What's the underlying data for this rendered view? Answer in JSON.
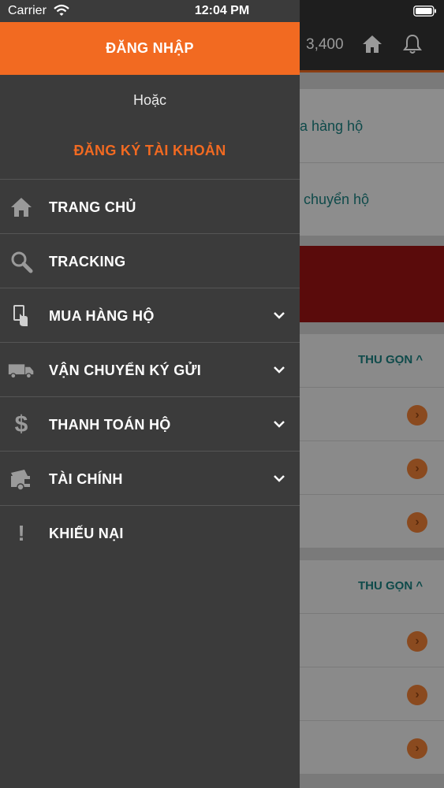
{
  "status_bar": {
    "carrier": "Carrier",
    "time": "12:04 PM"
  },
  "drawer": {
    "login_label": "ĐĂNG NHẬP",
    "or_label": "Hoặc",
    "register_label": "ĐĂNG KÝ TÀI KHOẢN",
    "menu": [
      {
        "label": "TRANG CHỦ",
        "icon": "home-icon"
      },
      {
        "label": "TRACKING",
        "icon": "search-icon"
      },
      {
        "label": "MUA HÀNG HỘ",
        "icon": "shopping-icon"
      },
      {
        "label": "VẬN CHUYỂN KÝ GỬI",
        "icon": "truck-icon"
      },
      {
        "label": "THANH TOÁN HỘ",
        "icon": "dollar-icon"
      },
      {
        "label": "TÀI CHÍNH",
        "icon": "finance-icon"
      },
      {
        "label": "KHIẾU NẠI",
        "icon": "exclamation-icon"
      }
    ]
  },
  "background": {
    "balance": "3,400",
    "card_links": [
      "a hàng hộ",
      "chuyển hộ"
    ],
    "collapse_label": "THU GỌN"
  },
  "colors": {
    "accent": "#f26a21",
    "drawer_bg": "#3b3b3b",
    "link_teal": "#0e4a4a"
  }
}
